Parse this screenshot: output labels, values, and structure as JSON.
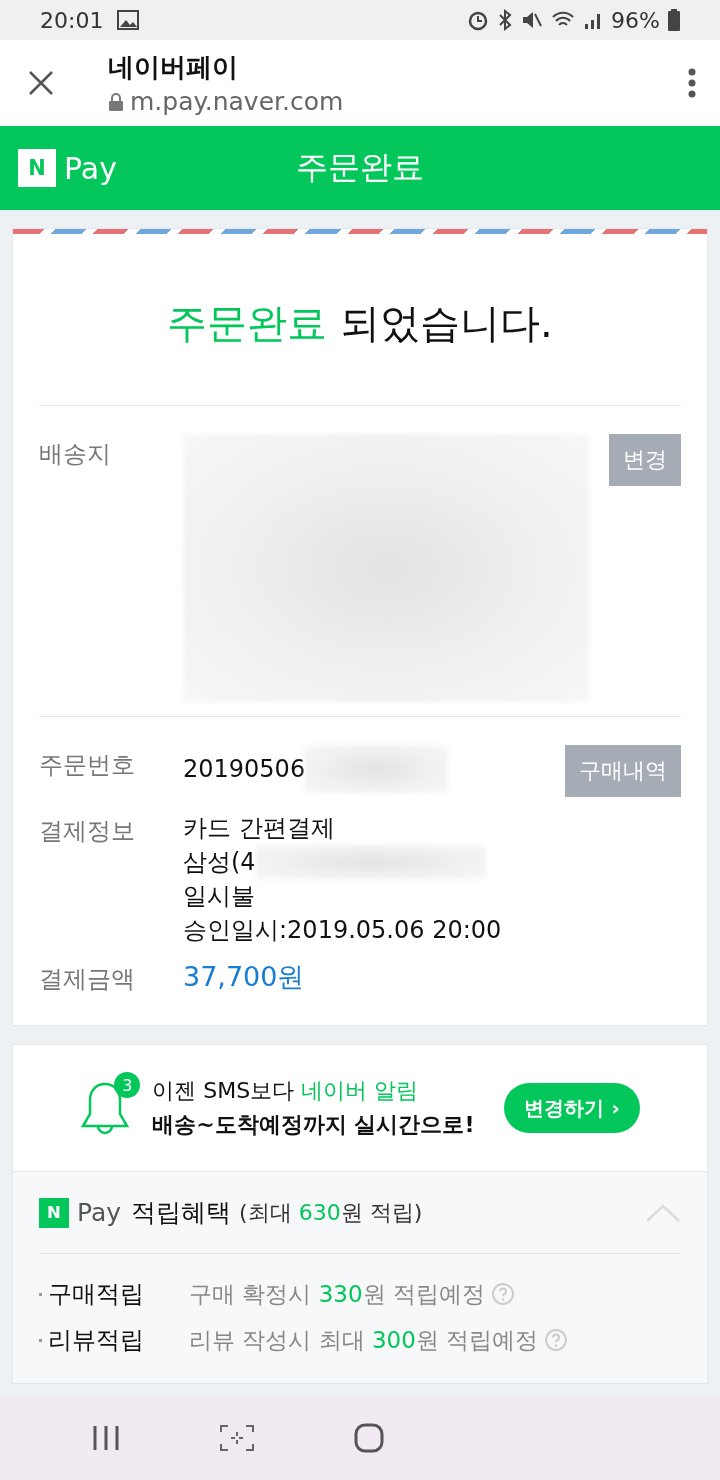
{
  "status_bar": {
    "time": "20:01",
    "battery": "96%"
  },
  "browser": {
    "title": "네이버페이",
    "url": "m.pay.naver.com"
  },
  "header": {
    "logo_letter": "N",
    "logo_text": "Pay",
    "title": "주문완료"
  },
  "headline": [
    {
      "text": "주문완료",
      "highlight": true
    },
    {
      "text": " 되었습니다.",
      "highlight": false
    }
  ],
  "address": {
    "label": "배송지",
    "masked": true,
    "button": "변경"
  },
  "order": {
    "label": "주문번호",
    "value": "20190506",
    "masked": true,
    "button": "구매내역"
  },
  "payment": {
    "label": "결제정보",
    "lines": [
      {
        "text": "카드 간편결제",
        "masked": false
      },
      {
        "text": "삼성(4",
        "masked": true
      },
      {
        "text": "일시불",
        "masked": false
      },
      {
        "text": "승인일시:2019.05.06 20:00",
        "masked": false
      }
    ]
  },
  "amount": {
    "label": "결제금액",
    "value": "37,700원"
  },
  "notice": {
    "badge": "3",
    "line1": [
      {
        "text": "이젠 SMS보다 ",
        "highlight": false
      },
      {
        "text": "네이버 알림",
        "highlight": true
      }
    ],
    "line2": "배송~도착예정까지 실시간으로!",
    "button": "변경하기 ›"
  },
  "benefits": {
    "logo_letter": "N",
    "logo_text": "Pay",
    "title": "적립혜택",
    "summary": [
      {
        "text": "(최대 ",
        "highlight": false
      },
      {
        "text": "630",
        "highlight": true
      },
      {
        "text": "원 적립)",
        "highlight": false
      }
    ],
    "expanded": true,
    "items": [
      {
        "label": "구매적립",
        "parts": [
          {
            "text": "구매 확정시 ",
            "highlight": false
          },
          {
            "text": "330",
            "highlight": true
          },
          {
            "text": "원 적립예정",
            "highlight": false
          }
        ]
      },
      {
        "label": "리뷰적립",
        "parts": [
          {
            "text": "리뷰 작성시 최대 ",
            "highlight": false
          },
          {
            "text": "300",
            "highlight": true
          },
          {
            "text": "원 적립예정",
            "highlight": false
          }
        ]
      }
    ]
  }
}
